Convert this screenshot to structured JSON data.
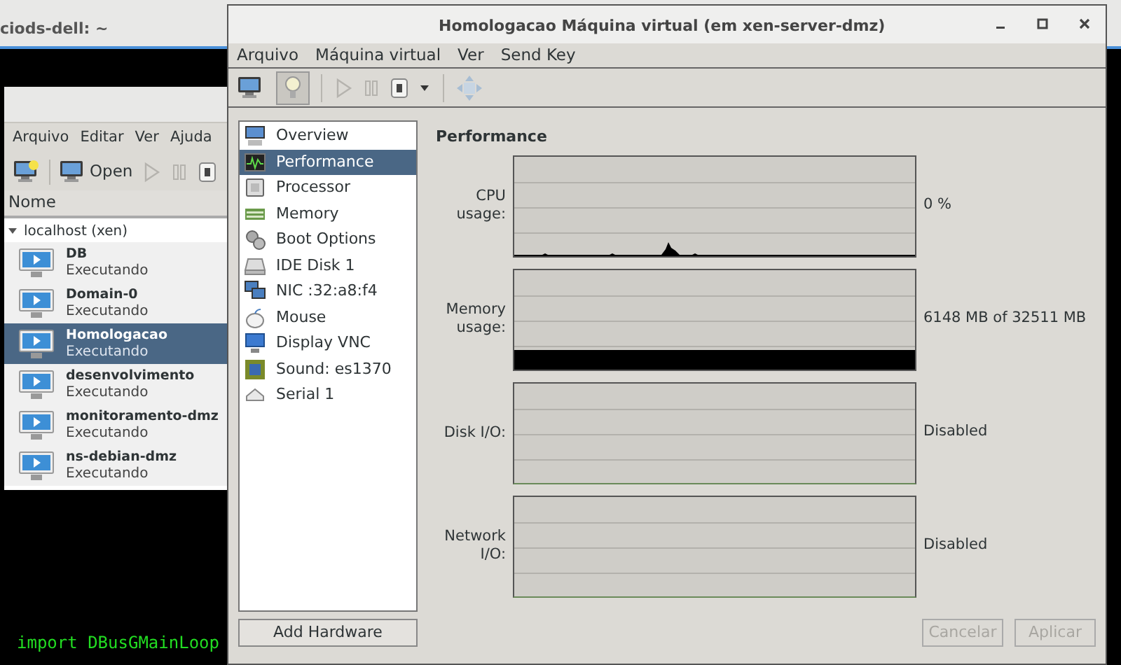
{
  "terminal": {
    "title": "ciods-dell: ~",
    "output": "import DBusGMainLoop"
  },
  "manager": {
    "menu": [
      "Arquivo",
      "Editar",
      "Ver",
      "Ajuda"
    ],
    "toolbar": [
      {
        "kind": "new"
      },
      {
        "kind": "open",
        "label": "Open"
      },
      {
        "kind": "play"
      },
      {
        "kind": "pause"
      },
      {
        "kind": "stop"
      }
    ],
    "column": "Nome",
    "host": {
      "label": "localhost (xen)",
      "expanded": true,
      "vms": [
        {
          "name": "DB",
          "status": "Executando",
          "selected": false
        },
        {
          "name": "Domain-0",
          "status": "Executando",
          "selected": false
        },
        {
          "name": "Homologacao",
          "status": "Executando",
          "selected": true
        },
        {
          "name": "desenvolvimento",
          "status": "Executando",
          "selected": false
        },
        {
          "name": "monitoramento-dmz",
          "status": "Executando",
          "selected": false
        },
        {
          "name": "ns-debian-dmz",
          "status": "Executando",
          "selected": false
        }
      ]
    }
  },
  "vm_window": {
    "title": "Homologacao Máquina virtual (em xen-server-dmz)",
    "menu": [
      "Arquivo",
      "Máquina virtual",
      "Ver",
      "Send Key"
    ],
    "toolbar": [
      {
        "kind": "console",
        "selected": false
      },
      {
        "kind": "details",
        "selected": true
      },
      {
        "kind": "play"
      },
      {
        "kind": "pause"
      },
      {
        "kind": "stop"
      },
      {
        "kind": "dropdown"
      },
      {
        "kind": "move"
      }
    ],
    "hardware": [
      {
        "kind": "overview",
        "label": "Overview",
        "selected": false
      },
      {
        "kind": "performance",
        "label": "Performance",
        "selected": true
      },
      {
        "kind": "processor",
        "label": "Processor",
        "selected": false
      },
      {
        "kind": "memory",
        "label": "Memory",
        "selected": false
      },
      {
        "kind": "boot",
        "label": "Boot Options",
        "selected": false
      },
      {
        "kind": "disk",
        "label": "IDE Disk 1",
        "selected": false
      },
      {
        "kind": "nic",
        "label": "NIC :32:a8:f4",
        "selected": false
      },
      {
        "kind": "mouse",
        "label": "Mouse",
        "selected": false
      },
      {
        "kind": "display",
        "label": "Display VNC",
        "selected": false
      },
      {
        "kind": "sound",
        "label": "Sound: es1370",
        "selected": false
      },
      {
        "kind": "serial",
        "label": "Serial 1",
        "selected": false
      }
    ],
    "add_button": "Add Hardware",
    "heading": "Performance",
    "graphs": [
      {
        "kind": "cpu",
        "label": "CPU usage:",
        "value": "0 %"
      },
      {
        "kind": "memory",
        "label": "Memory usage:",
        "value": "6148 MB of 32511 MB"
      },
      {
        "kind": "disabled",
        "label": "Disk I/O:",
        "value": "Disabled"
      },
      {
        "kind": "disabled",
        "label": "Network I/O:",
        "value": "Disabled"
      }
    ],
    "buttons": [
      {
        "label": "Cancelar",
        "disabled": true
      },
      {
        "label": "Aplicar",
        "disabled": true
      }
    ]
  }
}
